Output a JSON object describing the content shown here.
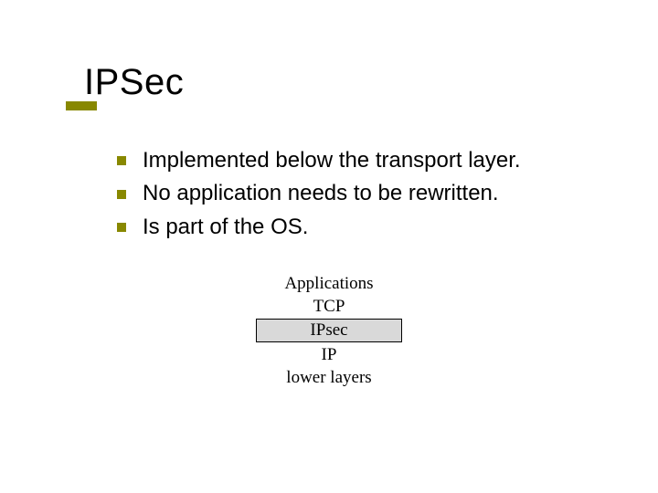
{
  "title": "IPSec",
  "bullets": [
    "Implemented below the transport layer.",
    "No application needs to be rewritten.",
    "Is part of the OS."
  ],
  "stack": {
    "applications": "Applications",
    "tcp": "TCP",
    "ipsec": "IPsec",
    "ip": "IP",
    "lower": "lower layers"
  }
}
